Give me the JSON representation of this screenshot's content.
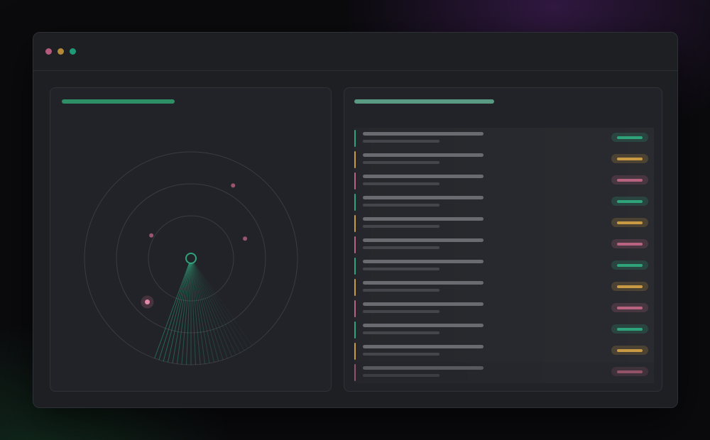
{
  "window": {
    "controls": [
      {
        "name": "close",
        "color": "#b45a7a"
      },
      {
        "name": "minimize",
        "color": "#b48a3a"
      },
      {
        "name": "maximize",
        "color": "#1f9a78"
      }
    ]
  },
  "colors": {
    "green": "#2fa37a",
    "amber": "#c89a44",
    "pink": "#b8637f",
    "panel_title_left": "#2e8f67",
    "panel_title_right": "#5a9a82"
  },
  "radar": {
    "blips": [
      {
        "angle_deg": 300,
        "radius_frac": 0.79,
        "color": "pink"
      },
      {
        "angle_deg": 340,
        "radius_frac": 0.54,
        "color": "pink"
      },
      {
        "angle_deg": 210,
        "radius_frac": 0.43,
        "color": "pink"
      },
      {
        "angle_deg": 135,
        "radius_frac": 0.58,
        "color": "pink",
        "highlight": true
      }
    ],
    "sweep_start_deg": 110,
    "sweep_span_deg": 55
  },
  "list": {
    "rows": [
      {
        "status": "green"
      },
      {
        "status": "amber"
      },
      {
        "status": "pink"
      },
      {
        "status": "green"
      },
      {
        "status": "amber"
      },
      {
        "status": "pink"
      },
      {
        "status": "green"
      },
      {
        "status": "amber"
      },
      {
        "status": "pink"
      },
      {
        "status": "green"
      },
      {
        "status": "amber"
      },
      {
        "status": "pink",
        "faded": true
      }
    ]
  }
}
